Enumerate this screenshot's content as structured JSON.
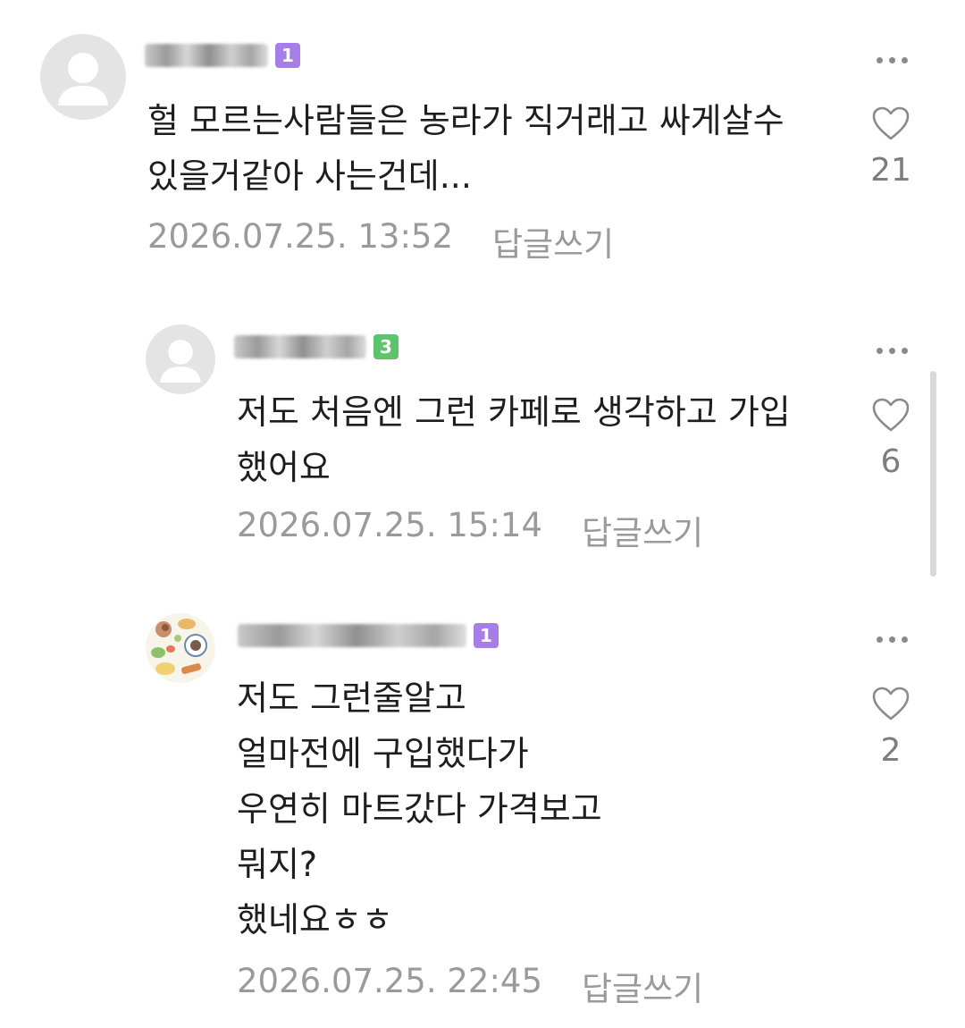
{
  "comments": [
    {
      "nickname_obscured": true,
      "level": "1",
      "level_color": "#a77ee8",
      "text": "헐 모르는사람들은 농라가 직거래고 싸게살수\n있을거같아 사는건데...",
      "date": "2026.07.25. 13:52",
      "reply_label": "답글쓰기",
      "likes": "21",
      "avatar": "default-user-icon",
      "is_reply": false
    },
    {
      "nickname_obscured": true,
      "level": "3",
      "level_color": "#5cc46a",
      "text": "저도 처음엔 그런 카페로 생각하고 가입\n했어요",
      "date": "2026.07.25. 15:14",
      "reply_label": "답글쓰기",
      "likes": "6",
      "avatar": "default-user-icon",
      "is_reply": true
    },
    {
      "nickname_obscured": true,
      "level": "1",
      "level_color": "#a77ee8",
      "text": "저도 그런줄알고\n얼마전에 구입했다가\n우연히 마트갔다 가격보고\n뭐지?\n했네요ㅎㅎ",
      "date": "2026.07.25. 22:45",
      "reply_label": "답글쓰기",
      "likes": "2",
      "avatar": "food-illustration-avatar",
      "is_reply": true
    }
  ],
  "icons": {
    "more": "more-dots-icon",
    "like": "heart-outline-icon"
  },
  "colors": {
    "text": "#1e1e1e",
    "meta": "#9a9a9a",
    "icon": "#8a8a8a"
  }
}
